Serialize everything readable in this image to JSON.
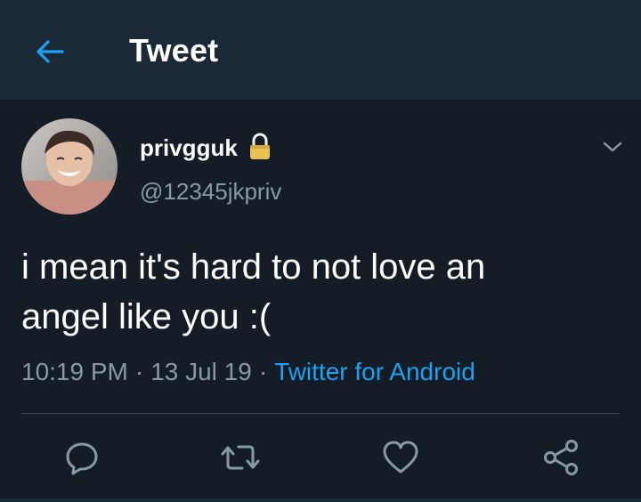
{
  "header": {
    "title": "Tweet",
    "back_icon": "arrow-left-icon"
  },
  "colors": {
    "accent": "#1da1f2",
    "background": "#141d26",
    "header_background": "#1b2836",
    "secondary_text": "#8899a6"
  },
  "tweet": {
    "display_name": "privgguk",
    "handle": "@12345jkpriv",
    "protected_icon": "lock-icon",
    "text": "i mean it's hard to not love an\nangel like you :(",
    "time": "10:19 PM",
    "date": "13 Jul 19",
    "separator": "·",
    "source": "Twitter for Android",
    "caret_icon": "chevron-down-icon"
  },
  "actions": [
    {
      "name": "reply",
      "icon": "reply-icon"
    },
    {
      "name": "retweet",
      "icon": "retweet-icon"
    },
    {
      "name": "like",
      "icon": "heart-icon"
    },
    {
      "name": "share",
      "icon": "share-icon"
    }
  ]
}
